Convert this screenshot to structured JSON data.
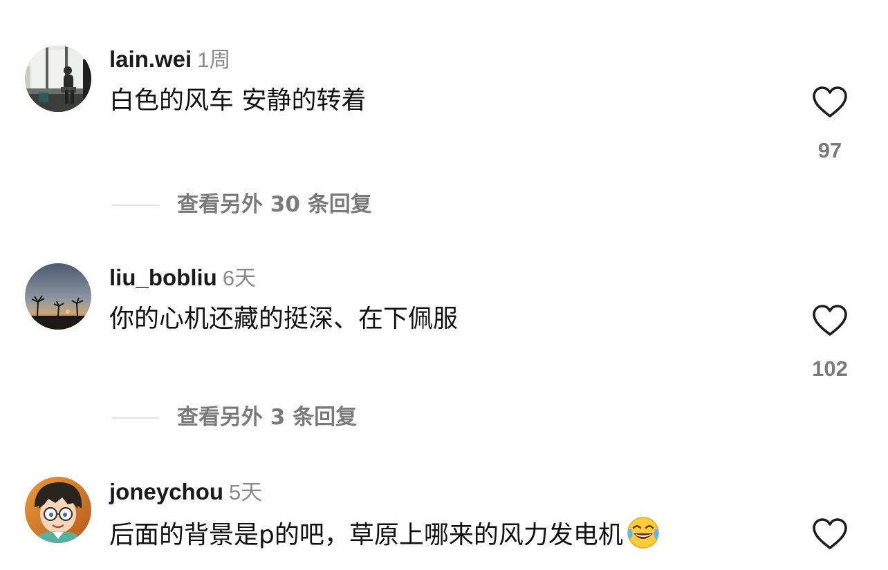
{
  "comments": [
    {
      "username": "lain.wei",
      "time": "1周",
      "text": "白色的风车 安静的转着",
      "likes": "97",
      "replies_label": "查看另外 30 条回复",
      "avatar_icon": "avatar-photo-person-window",
      "emoji": ""
    },
    {
      "username": "liu_bobliu",
      "time": "6天",
      "text": "你的心机还藏的挺深、在下佩服",
      "likes": "102",
      "replies_label": "查看另外 3 条回复",
      "avatar_icon": "avatar-photo-sunset-palms",
      "emoji": ""
    },
    {
      "username": "joneychou",
      "time": "5天",
      "text": "后面的背景是p的吧，草原上哪来的风力发电机",
      "likes": "",
      "replies_label": "",
      "avatar_icon": "avatar-cartoon-character",
      "emoji": "tears-of-joy-emoji"
    }
  ],
  "colors": {
    "text": "#111111",
    "muted": "#8a8a8a",
    "secondary": "#7a7a7a",
    "divider": "#e3e3e3",
    "background": "#ffffff"
  }
}
